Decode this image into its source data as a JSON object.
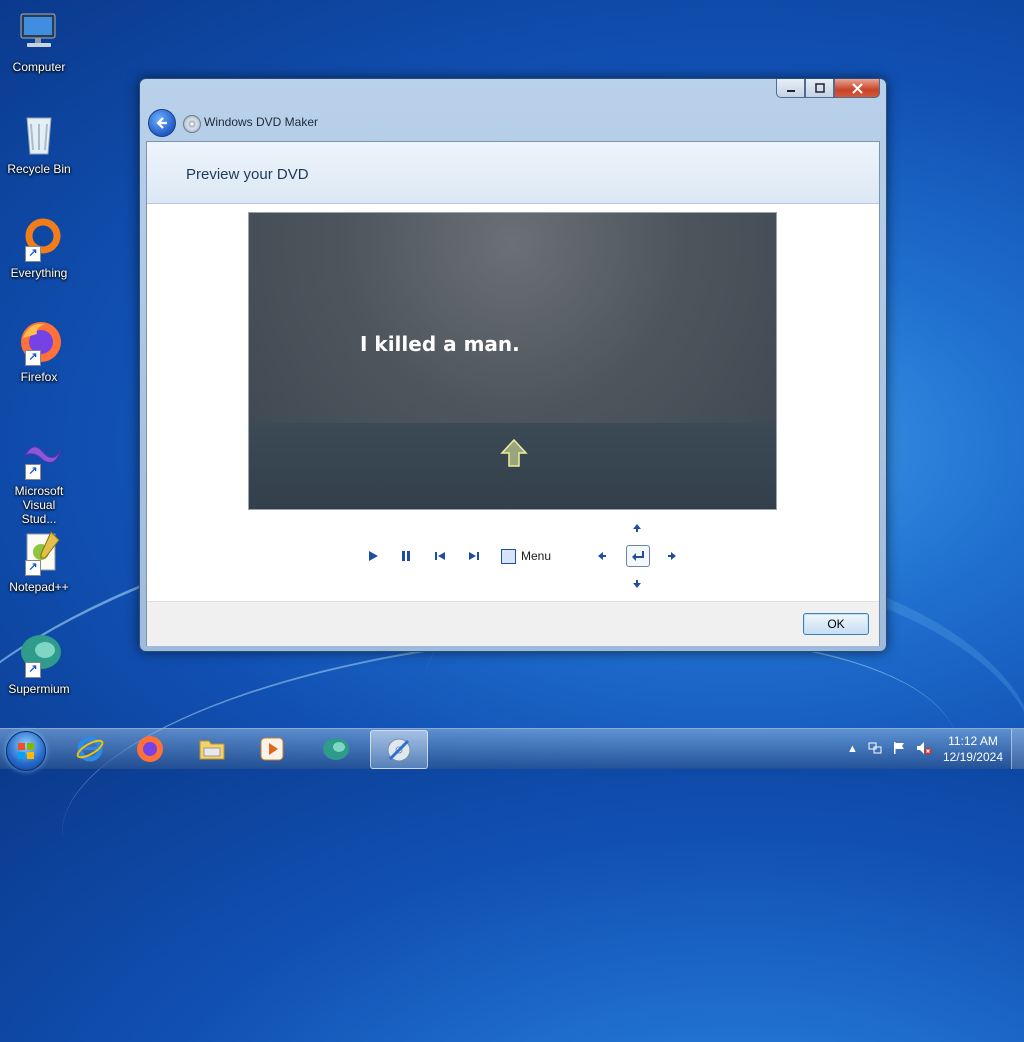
{
  "desktop": {
    "icons": [
      {
        "label": "Computer"
      },
      {
        "label": "Recycle Bin"
      },
      {
        "label": "Everything"
      },
      {
        "label": "Firefox"
      },
      {
        "label": "Microsoft Visual Stud..."
      },
      {
        "label": "Notepad++"
      },
      {
        "label": "Supermium"
      }
    ]
  },
  "window": {
    "title": "Windows DVD Maker",
    "header": "Preview your DVD",
    "preview": {
      "caption": "I killed a man."
    },
    "controls": {
      "menu_label": "Menu"
    },
    "ok_label": "OK"
  },
  "taskbar": {
    "apps": [
      "Internet Explorer",
      "Firefox",
      "File Explorer",
      "Windows Media Player",
      "Supermium",
      "Windows DVD Maker"
    ],
    "clock_time": "11:12 AM",
    "clock_date": "12/19/2024"
  },
  "colors": {
    "accent": "#1e4f9e",
    "desktop": "#1150b3"
  }
}
